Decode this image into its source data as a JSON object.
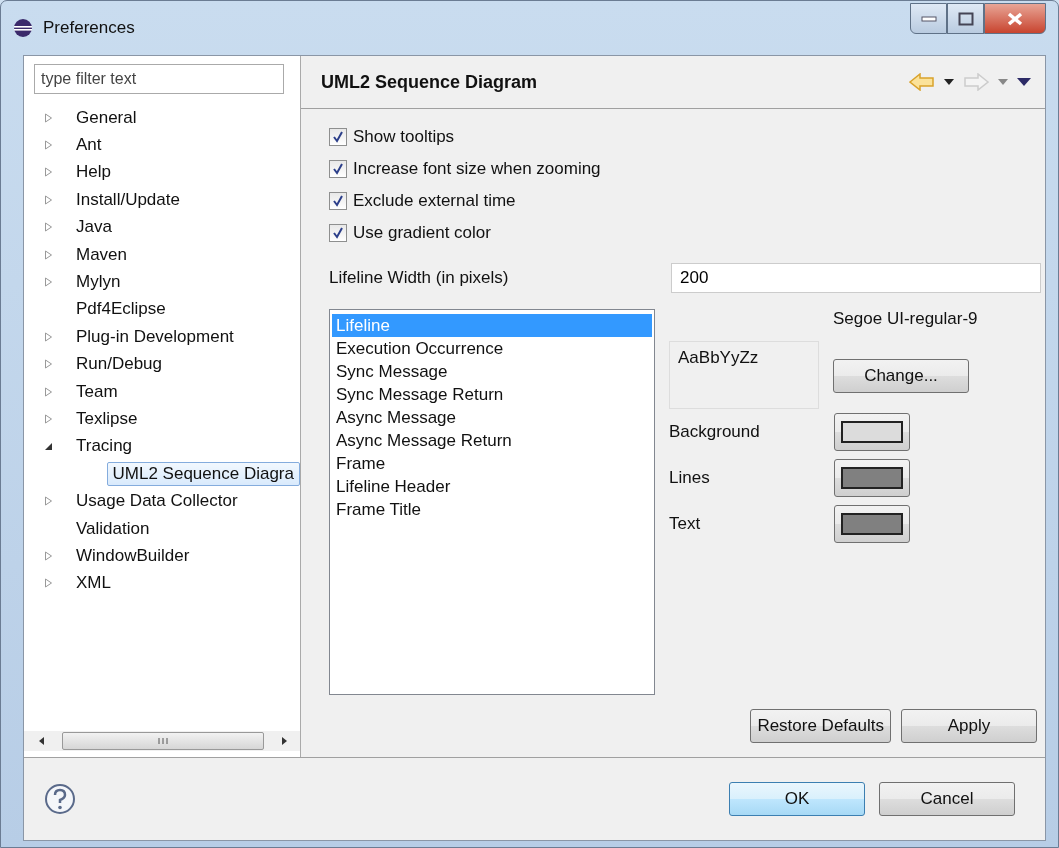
{
  "window": {
    "title": "Preferences"
  },
  "filter": {
    "placeholder": "type filter text"
  },
  "tree": [
    {
      "label": "General",
      "expanded": false,
      "selected": false
    },
    {
      "label": "Ant",
      "expanded": false,
      "selected": false
    },
    {
      "label": "Help",
      "expanded": false,
      "selected": false
    },
    {
      "label": "Install/Update",
      "expanded": false,
      "selected": false
    },
    {
      "label": "Java",
      "expanded": false,
      "selected": false
    },
    {
      "label": "Maven",
      "expanded": false,
      "selected": false
    },
    {
      "label": "Mylyn",
      "expanded": false,
      "selected": false
    },
    {
      "label": "Pdf4Eclipse",
      "selected": false
    },
    {
      "label": "Plug-in Development",
      "expanded": false,
      "selected": false
    },
    {
      "label": "Run/Debug",
      "expanded": false,
      "selected": false
    },
    {
      "label": "Team",
      "expanded": false,
      "selected": false
    },
    {
      "label": "Texlipse",
      "expanded": false,
      "selected": false
    },
    {
      "label": "Tracing",
      "expanded": true,
      "selected": false,
      "children": [
        {
          "label": "UML2 Sequence Diagra",
          "selected": true
        }
      ]
    },
    {
      "label": "Usage Data Collector",
      "expanded": false,
      "selected": false
    },
    {
      "label": "Validation",
      "selected": false
    },
    {
      "label": "WindowBuilder",
      "expanded": false,
      "selected": false
    },
    {
      "label": "XML",
      "expanded": false,
      "selected": false
    }
  ],
  "page": {
    "title": "UML2 Sequence Diagram"
  },
  "options": [
    {
      "label": "Show tooltips",
      "checked": true
    },
    {
      "label": "Increase font size when zooming",
      "checked": true
    },
    {
      "label": "Exclude external time",
      "checked": true
    },
    {
      "label": "Use gradient color",
      "checked": true
    }
  ],
  "lifeline_width": {
    "label": "Lifeline Width (in pixels)",
    "value": "200"
  },
  "elements": [
    {
      "label": "Lifeline",
      "selected": true
    },
    {
      "label": "Execution Occurrence",
      "selected": false
    },
    {
      "label": "Sync Message",
      "selected": false
    },
    {
      "label": "Sync Message Return",
      "selected": false
    },
    {
      "label": "Async Message",
      "selected": false
    },
    {
      "label": "Async Message Return",
      "selected": false
    },
    {
      "label": "Frame",
      "selected": false
    },
    {
      "label": "Lifeline Header",
      "selected": false
    },
    {
      "label": "Frame Title",
      "selected": false
    }
  ],
  "font": {
    "name": "Segoe UI-regular-9",
    "sample": "AaBbYyZz",
    "button": "Change..."
  },
  "colors": [
    {
      "label": "Background",
      "color": "#dcdcdc"
    },
    {
      "label": "Lines",
      "color": "#808080"
    },
    {
      "label": "Text",
      "color": "#808080"
    }
  ],
  "page_buttons": [
    "Restore Defaults",
    "Apply"
  ],
  "dialog_buttons": [
    {
      "label": "OK",
      "default": true
    },
    {
      "label": "Cancel",
      "default": false
    }
  ]
}
